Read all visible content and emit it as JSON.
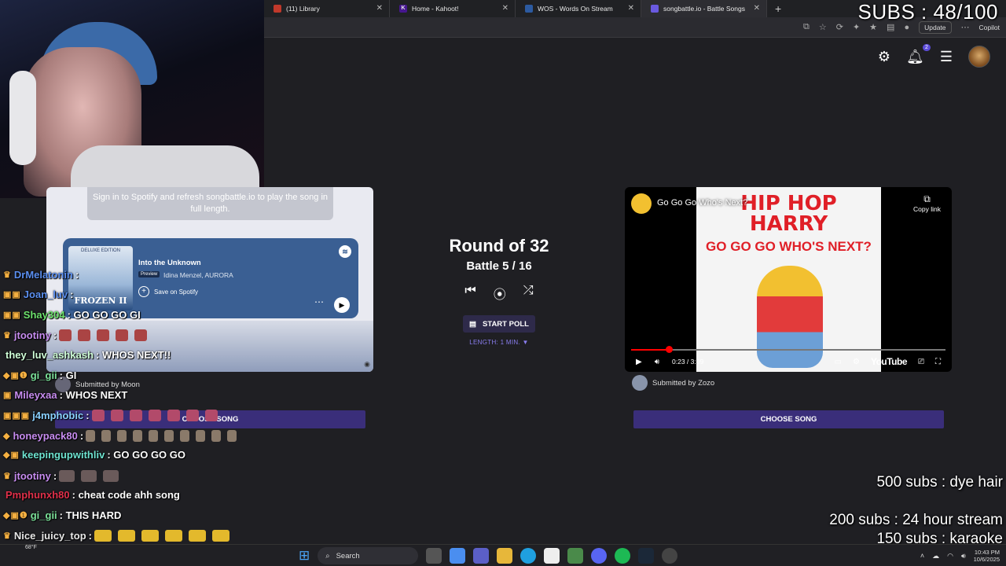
{
  "browser": {
    "tabs": [
      {
        "label": "(11) Library",
        "icon": "circle-red-icon"
      },
      {
        "label": "Home - Kahoot!",
        "icon": "kahoot-icon"
      },
      {
        "label": "WOS - Words On Stream",
        "icon": "wos-icon"
      },
      {
        "label": "songbattle.io - Battle Songs",
        "icon": "songbattle-icon",
        "active": true
      }
    ],
    "update_label": "Update",
    "copilot_label": "Copilot"
  },
  "overlay": {
    "subs_counter": "SUBS : 48/100",
    "goals": [
      "500 subs : dye hair",
      "200 subs : 24 hour stream",
      "150 subs : karaoke"
    ]
  },
  "site": {
    "notif_count": "2"
  },
  "left_song": {
    "notice": "Sign in to Spotify and refresh songbattle.io to play the song in full length.",
    "title": "Into the Unknown",
    "preview_badge": "Preview",
    "artist": "Idina Menzel, AURORA",
    "save_label": "Save on Spotify",
    "cover_edition": "DELUXE EDITION",
    "cover_title": "FROZEN II",
    "submitted_by": "Submitted by Moon"
  },
  "battle": {
    "round": "Round of 32",
    "battle": "Battle 5 / 16",
    "start_poll": "START POLL",
    "length": "LENGTH: 1 MIN. ▼"
  },
  "right_song": {
    "video_title": "Go Go Go Who's Next?",
    "thumb_line1": "HIP HOP",
    "thumb_line2": "HARRY",
    "thumb_line3": "GO GO GO WHO'S NEXT?",
    "copy_link": "Copy link",
    "time": "0:23 / 3:09",
    "progress": 0.12,
    "youtube_label": "YouTube",
    "submitted_by": "Submitted by Zozo",
    "choose_label": "CHOOSE SONG"
  },
  "chat": [
    {
      "user": "DrMelatonin",
      "color": "#5b8ff0",
      "badges": "♛",
      "text": ":"
    },
    {
      "user": "Joan_luv",
      "color": "#5b8ff0",
      "badges": "▣▣",
      "text": ":"
    },
    {
      "user": "Shay304",
      "color": "#6ee36e",
      "badges": "▣▣",
      "text": ": GO GO GO GI"
    },
    {
      "user": "jtootiny",
      "color": "#c78cf0",
      "badges": "♛",
      "text": ":"
    },
    {
      "user": "they_luv_ashkash",
      "color": "#d0ffd8",
      "badges": "",
      "text": ": WHOS NEXT!!"
    },
    {
      "user": "gi_gii",
      "color": "#7de39b",
      "badges": "◆▣❶",
      "text": ": GI"
    },
    {
      "user": "Mileyxaa",
      "color": "#c78cf0",
      "badges": "▣",
      "text": ": WHOS NEXT"
    },
    {
      "user": "j4mphobic",
      "color": "#8ad1ff",
      "badges": "▣▣▣",
      "text": ":"
    },
    {
      "user": "honeypack80",
      "color": "#c78cf0",
      "badges": "◆",
      "text": ":"
    },
    {
      "user": "keepingupwithliv",
      "color": "#6ee3d0",
      "badges": "◆▣",
      "text": ": GO GO GO GO"
    },
    {
      "user": "jtootiny",
      "color": "#c78cf0",
      "badges": "♛",
      "text": ":"
    },
    {
      "user": "Pmphunxh80",
      "color": "#e0304a",
      "badges": "",
      "text": ": cheat code ahh song"
    },
    {
      "user": "gi_gii",
      "color": "#7de39b",
      "badges": "◆▣❶",
      "text": ": THIS HARD"
    },
    {
      "user": "Nice_juicy_top",
      "color": "#e8e8e8",
      "badges": "♛",
      "text": ":"
    }
  ],
  "taskbar": {
    "search_placeholder": "Search",
    "weather": "68°F",
    "time": "10:43 PM",
    "date": "10/6/2025"
  }
}
